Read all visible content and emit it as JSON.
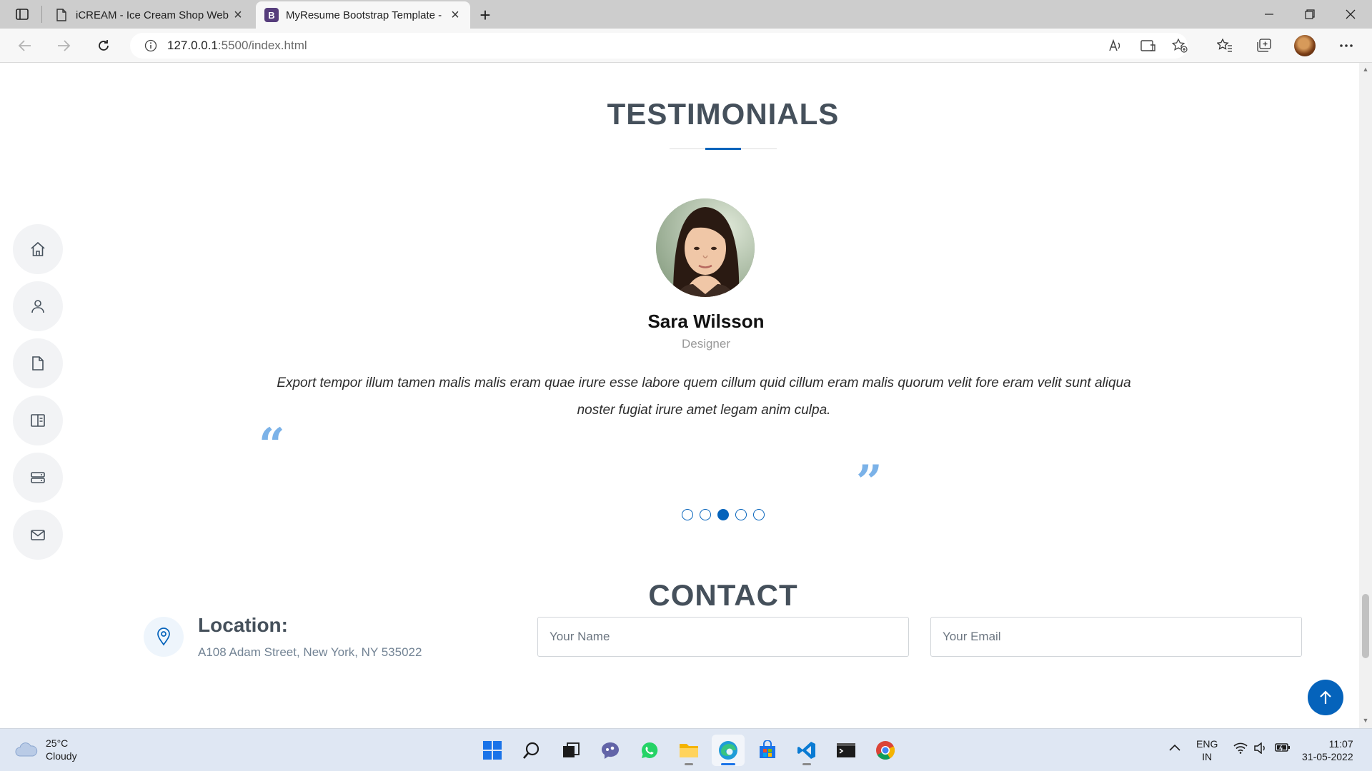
{
  "browser": {
    "tabs": [
      {
        "title": "iCREAM - Ice Cream Shop Websi",
        "active": false
      },
      {
        "title": "MyResume Bootstrap Template -",
        "active": true
      }
    ],
    "url_host": "127.0.0.1",
    "url_path": ":5500/index.html",
    "favicon_letter": "B",
    "new_tab_glyph": "+",
    "close_glyph": "×"
  },
  "side_nav": {
    "items": [
      {
        "name": "home",
        "icon": "home-icon"
      },
      {
        "name": "about",
        "icon": "person-icon"
      },
      {
        "name": "resume",
        "icon": "file-icon"
      },
      {
        "name": "portfolio",
        "icon": "book-icon"
      },
      {
        "name": "services",
        "icon": "server-icon"
      },
      {
        "name": "contact",
        "icon": "envelope-icon"
      }
    ]
  },
  "testimonials": {
    "title": "TESTIMONIALS",
    "name": "Sara Wilsson",
    "role": "Designer",
    "quote": "Export tempor illum tamen malis malis eram quae irure esse labore quem cillum quid cillum eram malis quorum velit fore eram velit sunt aliqua noster fugiat irure amet legam anim culpa.",
    "quote_open": "“",
    "quote_close": "”",
    "dots": 5,
    "active_dot": 3
  },
  "contact": {
    "title": "CONTACT",
    "location_label": "Location:",
    "location_value": "A108 Adam Street, New York, NY 535022",
    "name_placeholder": "Your Name",
    "email_placeholder": "Your Email"
  },
  "taskbar": {
    "weather_temp": "25°C",
    "weather_desc": "Cloudy",
    "lang_top": "ENG",
    "lang_bottom": "IN",
    "time": "11:07",
    "date": "31-05-2022",
    "apps": [
      "start",
      "search",
      "task-view",
      "teams-chat",
      "whatsapp",
      "file-explorer",
      "edge",
      "microsoft-store",
      "vscode",
      "terminal",
      "chrome"
    ]
  },
  "colors": {
    "accent": "#0563bb",
    "title_text": "#45505b",
    "quote_marks": "#7bb2e8"
  }
}
